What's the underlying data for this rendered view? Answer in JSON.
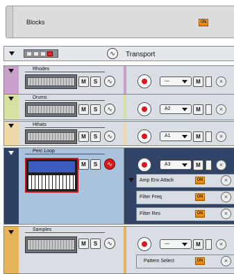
{
  "blocks": {
    "label": "Blocks",
    "on_badge": "ON"
  },
  "transport": {
    "label": "Transport"
  },
  "tracks": [
    {
      "name": "Rhodes",
      "mute": "M",
      "solo": "S",
      "pattern": "—",
      "m_label": "M",
      "color": "#c9a0c9"
    },
    {
      "name": "Drums",
      "mute": "M",
      "solo": "S",
      "pattern": "A2",
      "m_label": "M",
      "color": "#d9e1a0"
    },
    {
      "name": "Hihats",
      "mute": "M",
      "solo": "S",
      "pattern": "A1",
      "m_label": "M",
      "color": "#f0d9a8"
    },
    {
      "name": "Perc Loop",
      "mute": "M",
      "solo": "S",
      "pattern": "A3",
      "m_label": "M",
      "color": "#2d3f63"
    },
    {
      "name": "Samples",
      "mute": "M",
      "solo": "S",
      "pattern": "—",
      "m_label": "M",
      "color": "#e6b45a"
    }
  ],
  "perc_lanes": [
    {
      "label": "Amp Env Attack",
      "on": "ON"
    },
    {
      "label": "Filter Freq",
      "on": "ON"
    },
    {
      "label": "Filter Res",
      "on": "ON"
    }
  ],
  "samples_lanes": [
    {
      "label": "Pattern Select",
      "on": "ON"
    }
  ],
  "close_glyph": "×",
  "colors": {
    "accent_on": "#f39c12",
    "record": "#e0141e",
    "selected_border": "#d0101a"
  }
}
